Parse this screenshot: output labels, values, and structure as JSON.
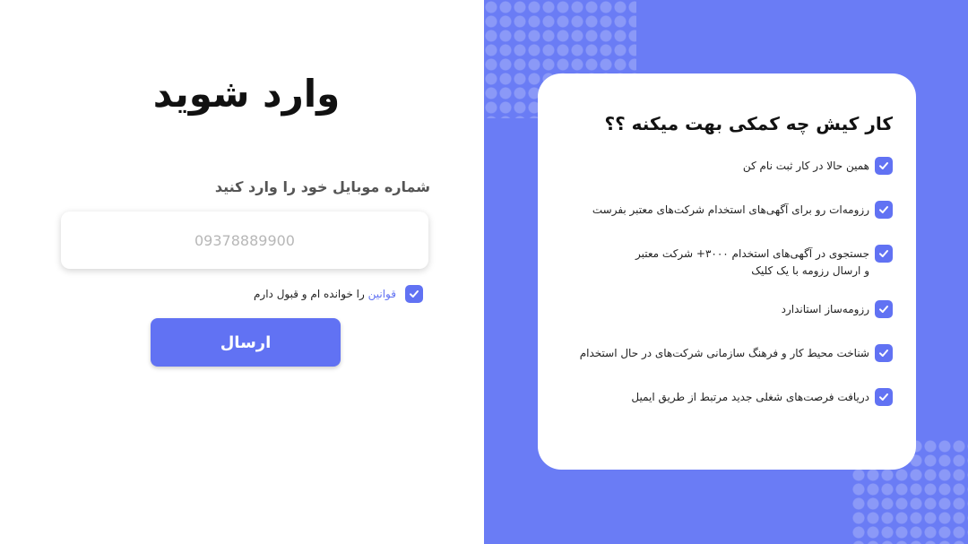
{
  "login": {
    "title": "وارد شوید",
    "phone_label": "شماره موبایل خود را وارد کنید",
    "phone_placeholder": "09378889900",
    "phone_value": "",
    "terms_link": "قوانین",
    "terms_rest": " را خوانده ام و قبول دارم",
    "terms_checked": true,
    "submit_label": "ارسال"
  },
  "promo": {
    "title": "کار کیش چه کمکی بهت میکنه ؟؟",
    "features": [
      "همین حالا در کار ثبت نام کن",
      "رزومه‌ات رو برای آگهی‌های استخدام شرکت‌های معتبر بفرست",
      "جستجوی در آگهی‌های استخدام ۳۰۰۰+ شرکت معتبر\nو ارسال رزومه با یک کلیک",
      "رزومه‌ساز استاندارد",
      "شناخت محیط کار و فرهنگ سازمانی شرکت‌های در حال استخدام",
      "دریافت فرصت‌های شغلی جدید مرتبط از طریق ایمیل"
    ]
  },
  "colors": {
    "accent": "#6172f3",
    "panel_background": "#6a7cf5",
    "text_dark": "#111111"
  }
}
